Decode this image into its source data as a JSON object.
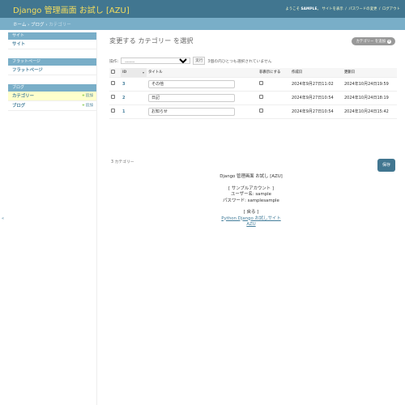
{
  "header": {
    "branding": "Django 管理画面 お試し [AZU]",
    "welcome_prefix": "ようこそ",
    "username": "SAMPLE",
    "welcome_suffix": "。",
    "view_site": "サイトを表示",
    "change_password": "パスワードの変更",
    "logout": "ログアウト"
  },
  "breadcrumbs": {
    "home": "ホーム",
    "app": "ブログ",
    "current": "カテゴリー"
  },
  "sidebar": {
    "modules": [
      {
        "header": "サイト",
        "items": [
          {
            "label": "サイト",
            "add": ""
          }
        ]
      },
      {
        "header": "フラットページ",
        "items": [
          {
            "label": "フラットページ",
            "add": ""
          }
        ]
      },
      {
        "header": "ブログ",
        "items": [
          {
            "label": "カテゴリー",
            "add": "追加"
          },
          {
            "label": "ブログ",
            "add": "追加"
          }
        ]
      }
    ],
    "toggle": "«"
  },
  "content": {
    "title": "変更する カテゴリー を選択",
    "add_button": "カテゴリー を追加",
    "add_plus": "+",
    "actions_label": "操作:",
    "actions_select": "---------",
    "go_button": "実行",
    "selection_counter": "3個の内ひとつも選択されていません",
    "columns": [
      "ID",
      "タイトル",
      "非表示にする",
      "作成日",
      "更新日"
    ],
    "rows": [
      {
        "id": "3",
        "title": "その他",
        "created": "2024年9月27日11:02",
        "updated": "2024年10月24日19:59"
      },
      {
        "id": "2",
        "title": "日記",
        "created": "2024年9月27日10:54",
        "updated": "2024年10月24日18:19"
      },
      {
        "id": "1",
        "title": "お知らせ",
        "created": "2024年9月27日10:54",
        "updated": "2024年10月24日15:42"
      }
    ],
    "result_count": "3 カテゴリー",
    "save_button": "保存"
  },
  "footer": {
    "line1": "Django 管理画面 お試し [AZU]",
    "line2": "[ サンプルアカウント ]",
    "line3": "ユーザー名: sample",
    "line4": "パスワード: samplesample",
    "line5": "[ 戻る ]",
    "link1": "Python Django お試しサイト",
    "link2": "AZU"
  }
}
